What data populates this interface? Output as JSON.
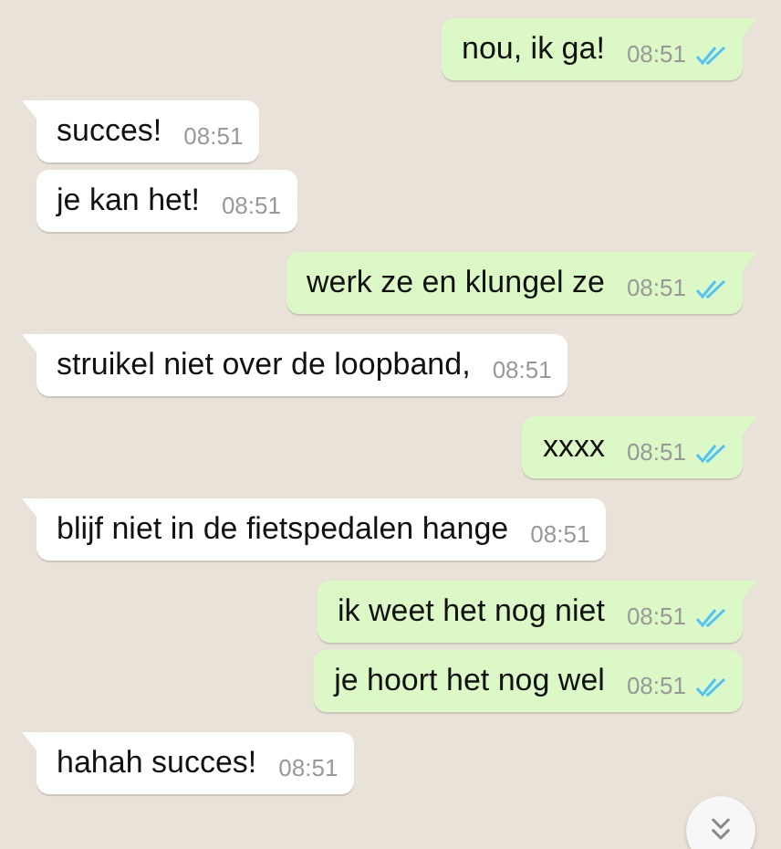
{
  "messages": [
    {
      "kind": "sent",
      "text": "nou, ik ga!",
      "time": "08:51",
      "tail": true,
      "read": true
    },
    {
      "kind": "received",
      "text": "succes!",
      "time": "08:51",
      "tail": true
    },
    {
      "kind": "received",
      "text": "je kan het!",
      "time": "08:51",
      "tail": false
    },
    {
      "kind": "sent",
      "text": "werk ze en klungel ze",
      "time": "08:51",
      "tail": true,
      "read": true
    },
    {
      "kind": "received",
      "text": "struikel niet over de loopband,",
      "time": "08:51",
      "tail": true
    },
    {
      "kind": "sent",
      "text": "xxxx",
      "time": "08:51",
      "tail": true,
      "read": true
    },
    {
      "kind": "received",
      "text": "blijf niet in de fietspedalen hange",
      "time": "08:51",
      "tail": true
    },
    {
      "kind": "sent",
      "text": "ik weet het nog niet",
      "time": "08:51",
      "tail": true,
      "read": true
    },
    {
      "kind": "sent",
      "text": "je hoort het nog wel",
      "time": "08:51",
      "tail": false,
      "read": true
    },
    {
      "kind": "received",
      "text": "hahah succes!",
      "time": "08:51",
      "tail": true
    }
  ],
  "scroll_down_button": {
    "visible": true
  }
}
